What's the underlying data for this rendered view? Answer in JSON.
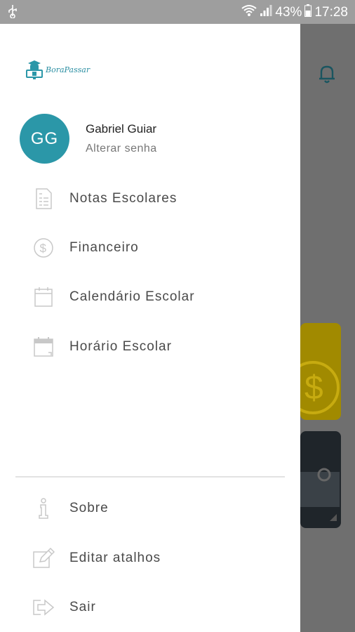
{
  "status_bar": {
    "battery": "43%",
    "time": "17:28",
    "icons": [
      "usb-icon",
      "wifi-icon",
      "signal-icon",
      "battery-icon"
    ]
  },
  "app": {
    "logo_text": "BoraPassar",
    "colors": {
      "accent": "#2b97a8",
      "card_yellow": "#a18a00",
      "card_dark": "#1f252a"
    }
  },
  "user": {
    "initials": "GG",
    "name": "Gabriel Guiar",
    "action": "Alterar senha"
  },
  "menu": {
    "main": [
      {
        "label": "Notas Escolares",
        "icon": "report-card-icon"
      },
      {
        "label": "Financeiro",
        "icon": "dollar-circle-icon"
      },
      {
        "label": "Calendário Escolar",
        "icon": "calendar-icon"
      },
      {
        "label": "Horário Escolar",
        "icon": "schedule-icon"
      }
    ],
    "footer": [
      {
        "label": "Sobre",
        "icon": "info-icon"
      },
      {
        "label": "Editar atalhos",
        "icon": "edit-icon"
      },
      {
        "label": "Sair",
        "icon": "logout-icon"
      }
    ]
  }
}
